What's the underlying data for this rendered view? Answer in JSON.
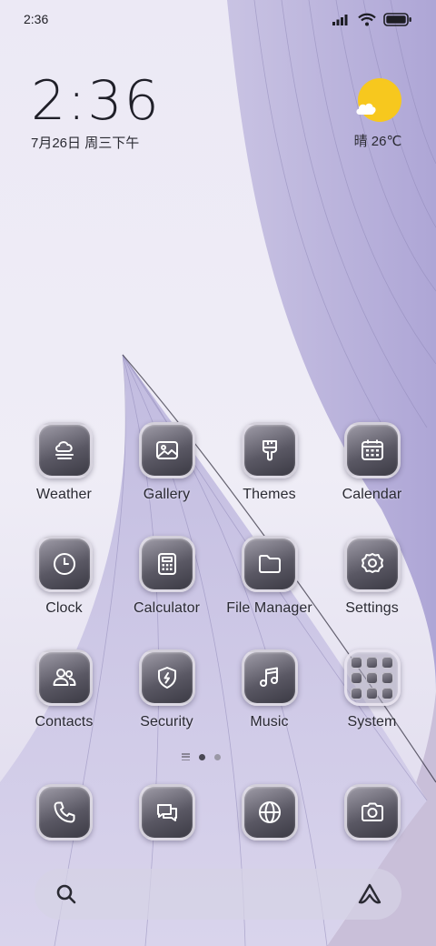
{
  "status_bar": {
    "time": "2:36",
    "icons": [
      "signal-icon",
      "wifi-icon",
      "battery-icon"
    ]
  },
  "clock_widget": {
    "time": "2:36",
    "date": "7月26日 周三下午"
  },
  "weather_widget": {
    "icon": "sunny-cloud-icon",
    "text": "晴 26℃",
    "sun_color": "#f7c81e"
  },
  "apps": [
    {
      "label": "Weather",
      "icon": "weather-icon"
    },
    {
      "label": "Gallery",
      "icon": "gallery-icon"
    },
    {
      "label": "Themes",
      "icon": "themes-icon"
    },
    {
      "label": "Calendar",
      "icon": "calendar-icon"
    },
    {
      "label": "Clock",
      "icon": "clock-icon"
    },
    {
      "label": "Calculator",
      "icon": "calculator-icon"
    },
    {
      "label": "File Manager",
      "icon": "folder-icon"
    },
    {
      "label": "Settings",
      "icon": "gear-icon"
    },
    {
      "label": "Contacts",
      "icon": "contacts-icon"
    },
    {
      "label": "Security",
      "icon": "shield-icon"
    },
    {
      "label": "Music",
      "icon": "music-note-icon"
    },
    {
      "label": "System",
      "icon": "system-folder-icon"
    }
  ],
  "page_indicator": {
    "pages": 2,
    "active_page": 1
  },
  "dock": [
    {
      "icon": "phone-icon"
    },
    {
      "icon": "messages-icon"
    },
    {
      "icon": "browser-icon"
    },
    {
      "icon": "camera-icon"
    }
  ],
  "search_bar": {
    "left_icon": "search-icon",
    "right_icon": "assistant-icon"
  },
  "colors": {
    "icon_gradient_top": "#9f9ca8",
    "icon_gradient_bottom": "#3b3a44",
    "text": "#2a2a33",
    "wallpaper_base": "#e9e5f3"
  }
}
